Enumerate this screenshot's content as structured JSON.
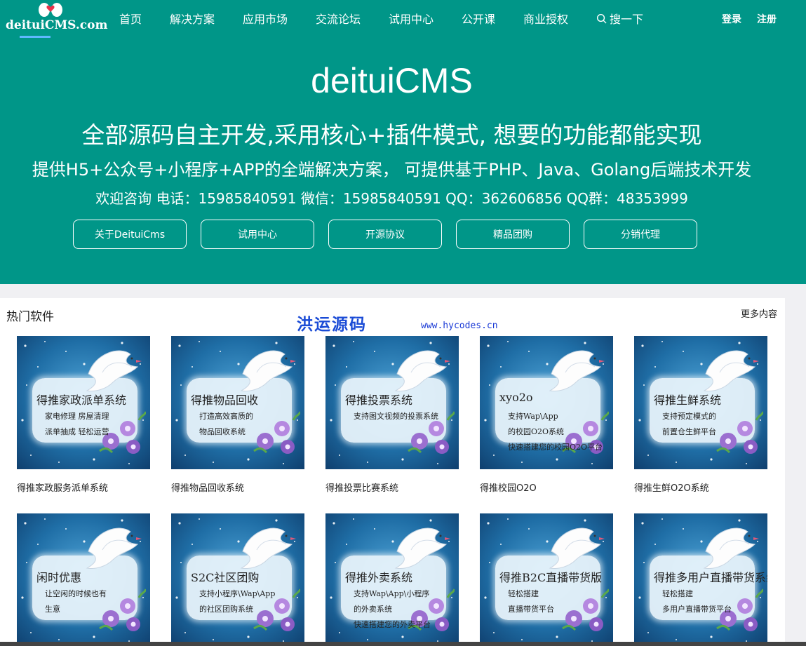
{
  "logo": {
    "text": "deituiCMS.com"
  },
  "nav": {
    "items": [
      "首页",
      "解决方案",
      "应用市场",
      "交流论坛",
      "试用中心",
      "公开课",
      "商业授权"
    ],
    "search_label": "搜一下",
    "login": "登录",
    "register": "注册"
  },
  "hero": {
    "title": "deituiCMS",
    "line1": "全部源码自主开发,采用核心+插件模式, 想要的功能都能实现",
    "line2": "提供H5+公众号+小程序+APP的全端解决方案， 可提供基于PHP、Java、Golang后端技术开发",
    "line3": "欢迎咨询 电话：15985840591 微信：15985840591 QQ：362606856 QQ群：48353999",
    "buttons": [
      "关于DeituiCms",
      "试用中心",
      "开源协议",
      "精品团购",
      "分销代理"
    ]
  },
  "section": {
    "title": "热门软件",
    "more": "更多内容",
    "watermark_cn": "洪运源码",
    "watermark_url": "www.hycodes.cn"
  },
  "products": [
    {
      "thumb_title": "得推家政派单系统",
      "thumb_sub": [
        "家电修理 房屋清理",
        "派单抽成 轻松运营"
      ],
      "caption": "得推家政服务派单系统"
    },
    {
      "thumb_title": "得推物品回收",
      "thumb_sub": [
        "打造高效高质的",
        "物品回收系统"
      ],
      "caption": "得推物品回收系统"
    },
    {
      "thumb_title": "得推投票系统",
      "thumb_sub": [
        "支持图文视频的投票系统"
      ],
      "caption": "得推投票比赛系统"
    },
    {
      "thumb_title": "xyo2o",
      "thumb_sub": [
        "支持Wap\\App",
        "的校园O2O系统",
        "快速搭建您的校园O2O平台"
      ],
      "caption": "得推校园O2O"
    },
    {
      "thumb_title": "得推生鲜系统",
      "thumb_sub": [
        "支持预定模式的",
        "前置仓生鲜平台"
      ],
      "caption": "得推生鲜O2O系统"
    },
    {
      "thumb_title": "闲时优惠",
      "thumb_sub": [
        "让空闲的时候也有",
        "生意"
      ],
      "caption": ""
    },
    {
      "thumb_title": "S2C社区团购",
      "thumb_sub": [
        "支持小程序\\Wap\\App",
        "的社区团购系统"
      ],
      "caption": ""
    },
    {
      "thumb_title": "得推外卖系统",
      "thumb_sub": [
        "支持Wap\\App\\小程序",
        "的外卖系统",
        "快速搭建您的外卖平台"
      ],
      "caption": ""
    },
    {
      "thumb_title": "得推B2C直播带货版",
      "thumb_sub": [
        "轻松搭建",
        "直播带货平台"
      ],
      "caption": ""
    },
    {
      "thumb_title": "得推多用户直播带货系统",
      "thumb_sub": [
        "轻松搭建",
        "多用户直播带货平台"
      ],
      "caption": ""
    }
  ],
  "colors": {
    "brand": "#009688",
    "watermark": "#1a4bd6"
  }
}
